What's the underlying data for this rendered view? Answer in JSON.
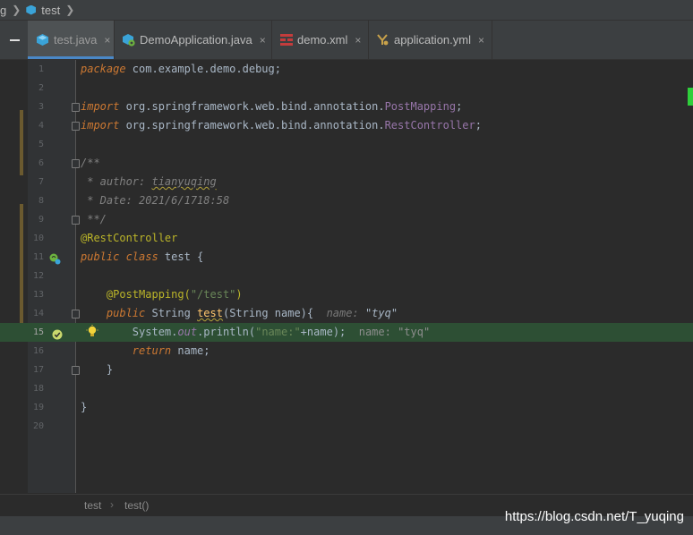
{
  "navbar": {
    "leading": "g",
    "project": "test"
  },
  "tabs": [
    {
      "label": "test.java",
      "icon": "java-class-icon",
      "active": true
    },
    {
      "label": "DemoApplication.java",
      "icon": "spring-boot-icon",
      "active": false
    },
    {
      "label": "demo.xml",
      "icon": "maven-icon",
      "active": false
    },
    {
      "label": "application.yml",
      "icon": "yaml-icon",
      "active": false
    }
  ],
  "close_glyph": "×",
  "line_numbers": [
    "1",
    "2",
    "3",
    "4",
    "5",
    "6",
    "7",
    "8",
    "9",
    "10",
    "11",
    "12",
    "13",
    "14",
    "15",
    "16",
    "17",
    "18",
    "19",
    "20"
  ],
  "code": {
    "l1_kw": "package",
    "l1_rest": " com.example.demo.debug;",
    "l3_kw": "import",
    "l3_pkg": " org.springframework.web.bind.annotation.",
    "l3_cls": "PostMapping",
    "l4_kw": "import",
    "l4_pkg": " org.springframework.web.bind.annotation.",
    "l4_cls": "RestController",
    "l6": "/**",
    "l7_a": " * author: ",
    "l7_b": "tianyuqing",
    "l8": " * Date: 2021/6/1718:58",
    "l9": " **/",
    "l10": "@RestController",
    "l11_a": "public ",
    "l11_b": "class",
    "l11_c": " test {",
    "l13_a": "    @PostMapping(",
    "l13_b": "\"/test\"",
    "l13_c": ")",
    "l14_a": "    public ",
    "l14_b": "String ",
    "l14_c": "test",
    "l14_d": "(String ",
    "l14_e": "name",
    "l14_f": "){  ",
    "l14_hint_name": "name: ",
    "l14_hint_val": "\"tyq\"",
    "l15_a": "        System.",
    "l15_b": "out",
    "l15_c": ".println(",
    "l15_d": "\"name:\"",
    "l15_e": "+",
    "l15_f": "name",
    "l15_g": ");  ",
    "l15_hint": "name: \"tyq\"",
    "l16_a": "        return ",
    "l16_b": "name",
    "l16_c": ";",
    "l17": "    }",
    "l19": "}"
  },
  "breadcrumbs": {
    "class": "test",
    "method": "test()"
  },
  "watermark": "https://blog.csdn.net/T_yuqing",
  "colors": {
    "keyword": "#cc7832",
    "annotation": "#bbb529",
    "string": "#6a8759",
    "comment": "#808080",
    "field": "#9876aa",
    "method": "#ffc66d",
    "execution_line": "#2d4f34",
    "tab_active_underline": "#4a88c7"
  }
}
